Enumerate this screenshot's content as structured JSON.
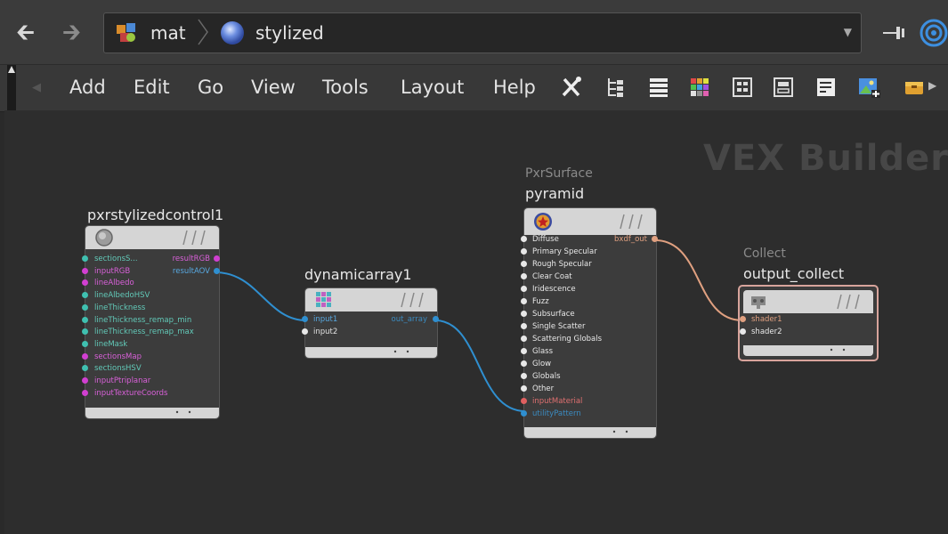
{
  "pathbar": {
    "crumbs": [
      "mat",
      "stylized"
    ]
  },
  "menu": {
    "items": [
      "Add",
      "Edit",
      "Go",
      "View",
      "Tools",
      "Layout",
      "Help"
    ]
  },
  "canvas": {
    "watermark": "VEX Builder"
  },
  "nodes": {
    "control": {
      "name": "pxrstylizedcontrol1",
      "inputs": [
        "sectionsS...",
        "inputRGB",
        "lineAlbedo",
        "lineAlbedoHSV",
        "lineThickness",
        "lineThickness_remap_min",
        "lineThickness_remap_max",
        "lineMask",
        "sectionsMap",
        "sectionsHSV",
        "inputPtriplanar",
        "inputTextureCoords"
      ],
      "outputs": [
        "resultRGB",
        "resultAOV"
      ]
    },
    "array": {
      "name": "dynamicarray1",
      "inputs": [
        "input1",
        "input2"
      ],
      "outputs": [
        "out_array"
      ]
    },
    "pyramid": {
      "type": "PxrSurface",
      "name": "pyramid",
      "inputs": [
        "Diffuse",
        "Primary Specular",
        "Rough Specular",
        "Clear Coat",
        "Iridescence",
        "Fuzz",
        "Subsurface",
        "Single Scatter",
        "Scattering Globals",
        "Glass",
        "Glow",
        "Globals",
        "Other",
        "inputMaterial",
        "utilityPattern"
      ],
      "outputs": [
        "bxdf_out"
      ]
    },
    "collect": {
      "type": "Collect",
      "name": "output_collect",
      "inputs": [
        "shader1",
        "shader2"
      ]
    }
  },
  "colors": {
    "cyan_port": "#3fc0b0",
    "magenta_port": "#d13fd1",
    "blue_wire": "#2f8fd0",
    "orange_wire": "#e0a080",
    "selected_border": "#d8a49c"
  }
}
